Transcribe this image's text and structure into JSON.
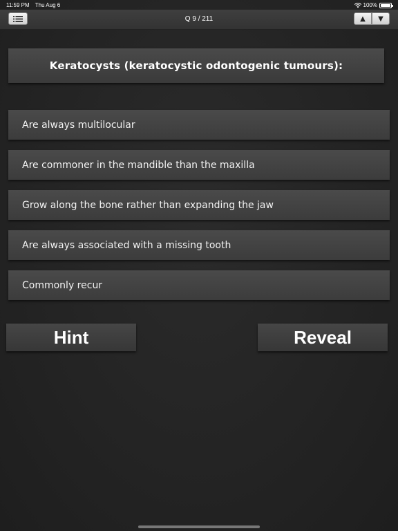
{
  "status": {
    "time": "11:59 PM",
    "date": "Thu Aug 6",
    "battery": "100%"
  },
  "nav": {
    "title": "Q 9 / 211",
    "up_label": "▲",
    "down_label": "▼"
  },
  "question": "Keratocysts (keratocystic odontogenic tumours):",
  "options": [
    "Are always multilocular",
    "Are commoner in the mandible than the maxilla",
    "Grow along the bone rather than expanding the jaw",
    "Are always associated with a missing tooth",
    "Commonly recur"
  ],
  "buttons": {
    "hint": "Hint",
    "reveal": "Reveal"
  }
}
